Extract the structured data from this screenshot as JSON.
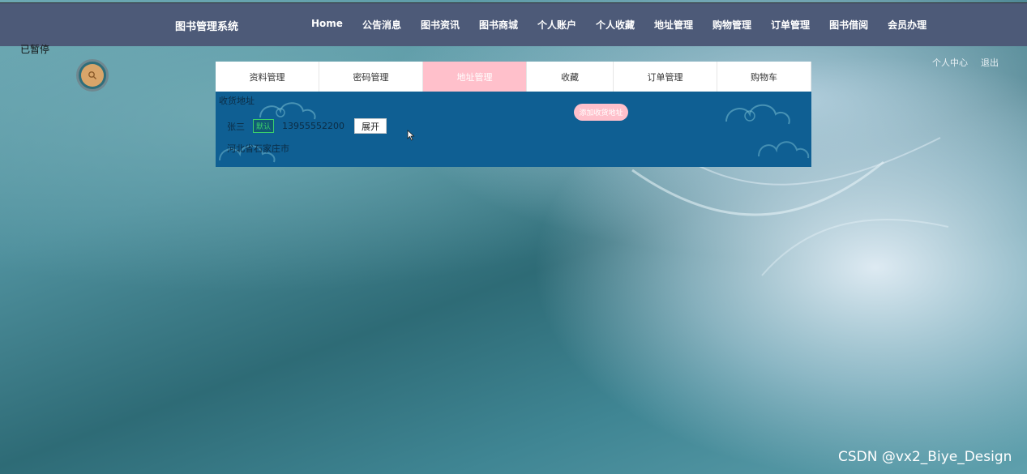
{
  "header": {
    "brand": "图书管理系统",
    "nav": [
      "Home",
      "公告消息",
      "图书资讯",
      "图书商城",
      "个人账户",
      "个人收藏",
      "地址管理",
      "购物管理",
      "订单管理",
      "图书借阅",
      "会员办理"
    ]
  },
  "overlay": {
    "paused_label": "已暂停"
  },
  "user_menu": {
    "center_label": "个人中心",
    "logout_label": "退出"
  },
  "tabs": [
    {
      "label": "资料管理",
      "active": false
    },
    {
      "label": "密码管理",
      "active": false
    },
    {
      "label": "地址管理",
      "active": true
    },
    {
      "label": "收藏",
      "active": false
    },
    {
      "label": "订单管理",
      "active": false
    },
    {
      "label": "购物车",
      "active": false
    }
  ],
  "address_panel": {
    "title": "收货地址",
    "add_button": "添加收货地址",
    "entry": {
      "name": "张三",
      "default_badge": "默认",
      "phone": "13955552200",
      "expand_button": "展开",
      "detail": "河北省石家庄市"
    }
  },
  "icons": {
    "avatar": "search-icon",
    "cursor": "mouse-pointer-icon"
  },
  "colors": {
    "topbar": "#4d5a78",
    "active_tab": "#ffc0cb",
    "panel_bg": "#0f5f93",
    "badge": "#3ad06b",
    "avatar": "#d9a56a"
  },
  "watermark": "CSDN @vx2_Biye_Design"
}
